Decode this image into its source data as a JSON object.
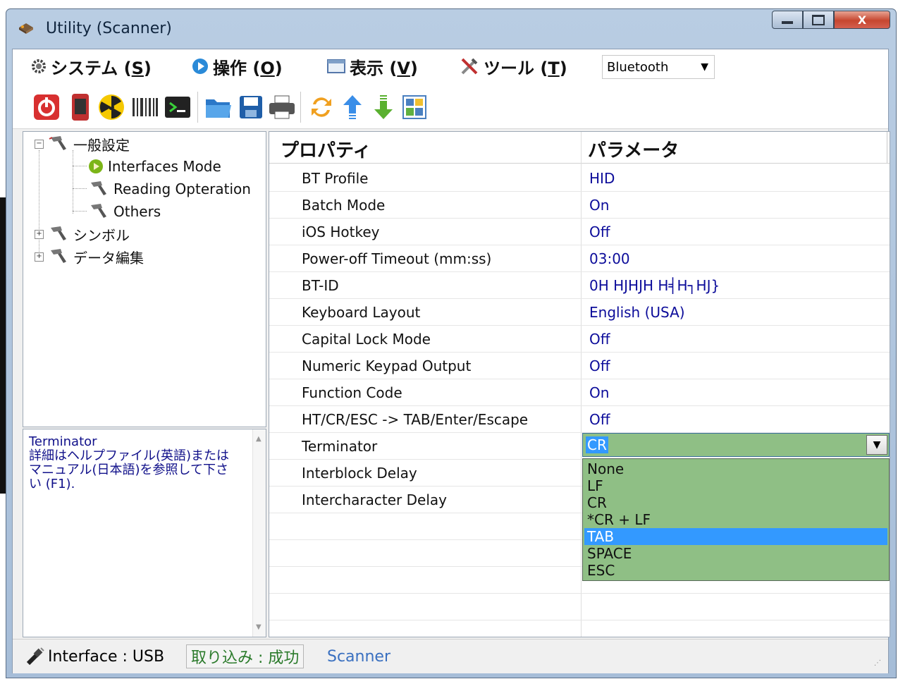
{
  "window": {
    "title": "Utility (Scanner)",
    "close_glyph": "X"
  },
  "menu": {
    "items": [
      {
        "label": "システム (",
        "key": "S",
        "suffix": ")",
        "icon": "gear-icon"
      },
      {
        "label": "操作 (",
        "key": "O",
        "suffix": ")",
        "icon": "play-circle-icon"
      },
      {
        "label": "表示 (",
        "key": "V",
        "suffix": ")",
        "icon": "window-view-icon"
      },
      {
        "label": "ツール (",
        "key": "T",
        "suffix": ")",
        "icon": "tools-icon"
      }
    ],
    "connection": "Bluetooth"
  },
  "toolbar": {
    "icons": [
      "power-icon",
      "phone-icon",
      "radiation-icon",
      "barcode-icon",
      "terminal-icon",
      "open-folder-icon",
      "save-icon",
      "print-icon",
      "sync-icon",
      "upload-icon",
      "download-icon",
      "layout-icon"
    ]
  },
  "tree": {
    "general": "一般設定",
    "interfaces_mode": "Interfaces Mode",
    "reading_operation": "Reading Opteration",
    "others": "Others",
    "symbol": "シンボル",
    "data_edit": "データ編集",
    "expand_minus": "−",
    "expand_plus": "+"
  },
  "description": {
    "title": "Terminator",
    "body": "詳細はヘルプファイル(英語)またはマニュアル(日本語)を参照して下さい (F1)."
  },
  "grid": {
    "header_property": "プロパティ",
    "header_parameter": "パラメータ",
    "rows": [
      {
        "property": "BT Profile",
        "value": "HID"
      },
      {
        "property": "Batch Mode",
        "value": "On"
      },
      {
        "property": "iOS Hotkey",
        "value": "Off"
      },
      {
        "property": "Power-off Timeout (mm:ss)",
        "value": "03:00"
      },
      {
        "property": "BT-ID",
        "value": "0H  HJHJH  H╡H┐HJ}"
      },
      {
        "property": "Keyboard Layout",
        "value": "English (USA)"
      },
      {
        "property": "Capital Lock Mode",
        "value": "Off"
      },
      {
        "property": "Numeric Keypad Output",
        "value": "Off"
      },
      {
        "property": "Function Code",
        "value": "On"
      },
      {
        "property": "HT/CR/ESC -> TAB/Enter/Escape",
        "value": "Off"
      },
      {
        "property": "Terminator",
        "value": ""
      },
      {
        "property": "Interblock Delay",
        "value": ""
      },
      {
        "property": "Intercharacter Delay",
        "value": ""
      }
    ],
    "terminator_selected": "CR",
    "terminator_options": [
      "None",
      "LF",
      "CR",
      "*CR + LF",
      "TAB",
      "SPACE",
      "ESC"
    ],
    "highlighted_option": "TAB"
  },
  "status": {
    "interface": "Interface : USB",
    "import_result": "取り込み : 成功",
    "device": "Scanner"
  },
  "colors": {
    "dropdown_bg": "#8fbf85",
    "highlight": "#3399ff",
    "value_text": "#0c0c9a"
  }
}
